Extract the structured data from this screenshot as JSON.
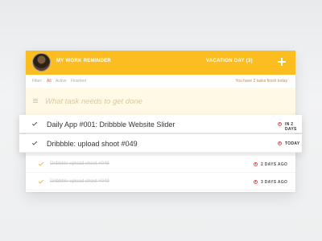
{
  "header": {
    "title": "MY WORK REMINDER",
    "vacation": "VACATION DAY (3)",
    "add_icon": "plus-icon",
    "accent": "#fbbd1f"
  },
  "filters": {
    "label": "Filter:",
    "all": "All",
    "active": "Active",
    "finished": "Finished",
    "remaining": "You have 2 tasks finish today"
  },
  "input": {
    "placeholder": "What task needs to get done",
    "value": ""
  },
  "tasks": [
    {
      "title": "Daily App #001: Dribbble Website Slider",
      "due": "IN 2 DAYS",
      "completed": false
    },
    {
      "title": "Dribbble: upload shoot #049",
      "due": "TODAY",
      "completed": false
    },
    {
      "title": "Dribbble-upload shoot #049",
      "due": "2 DAYS AGO",
      "completed": true
    },
    {
      "title": "Dribbble-upload shoot #049",
      "due": "3 DAYS AGO",
      "completed": true
    }
  ]
}
